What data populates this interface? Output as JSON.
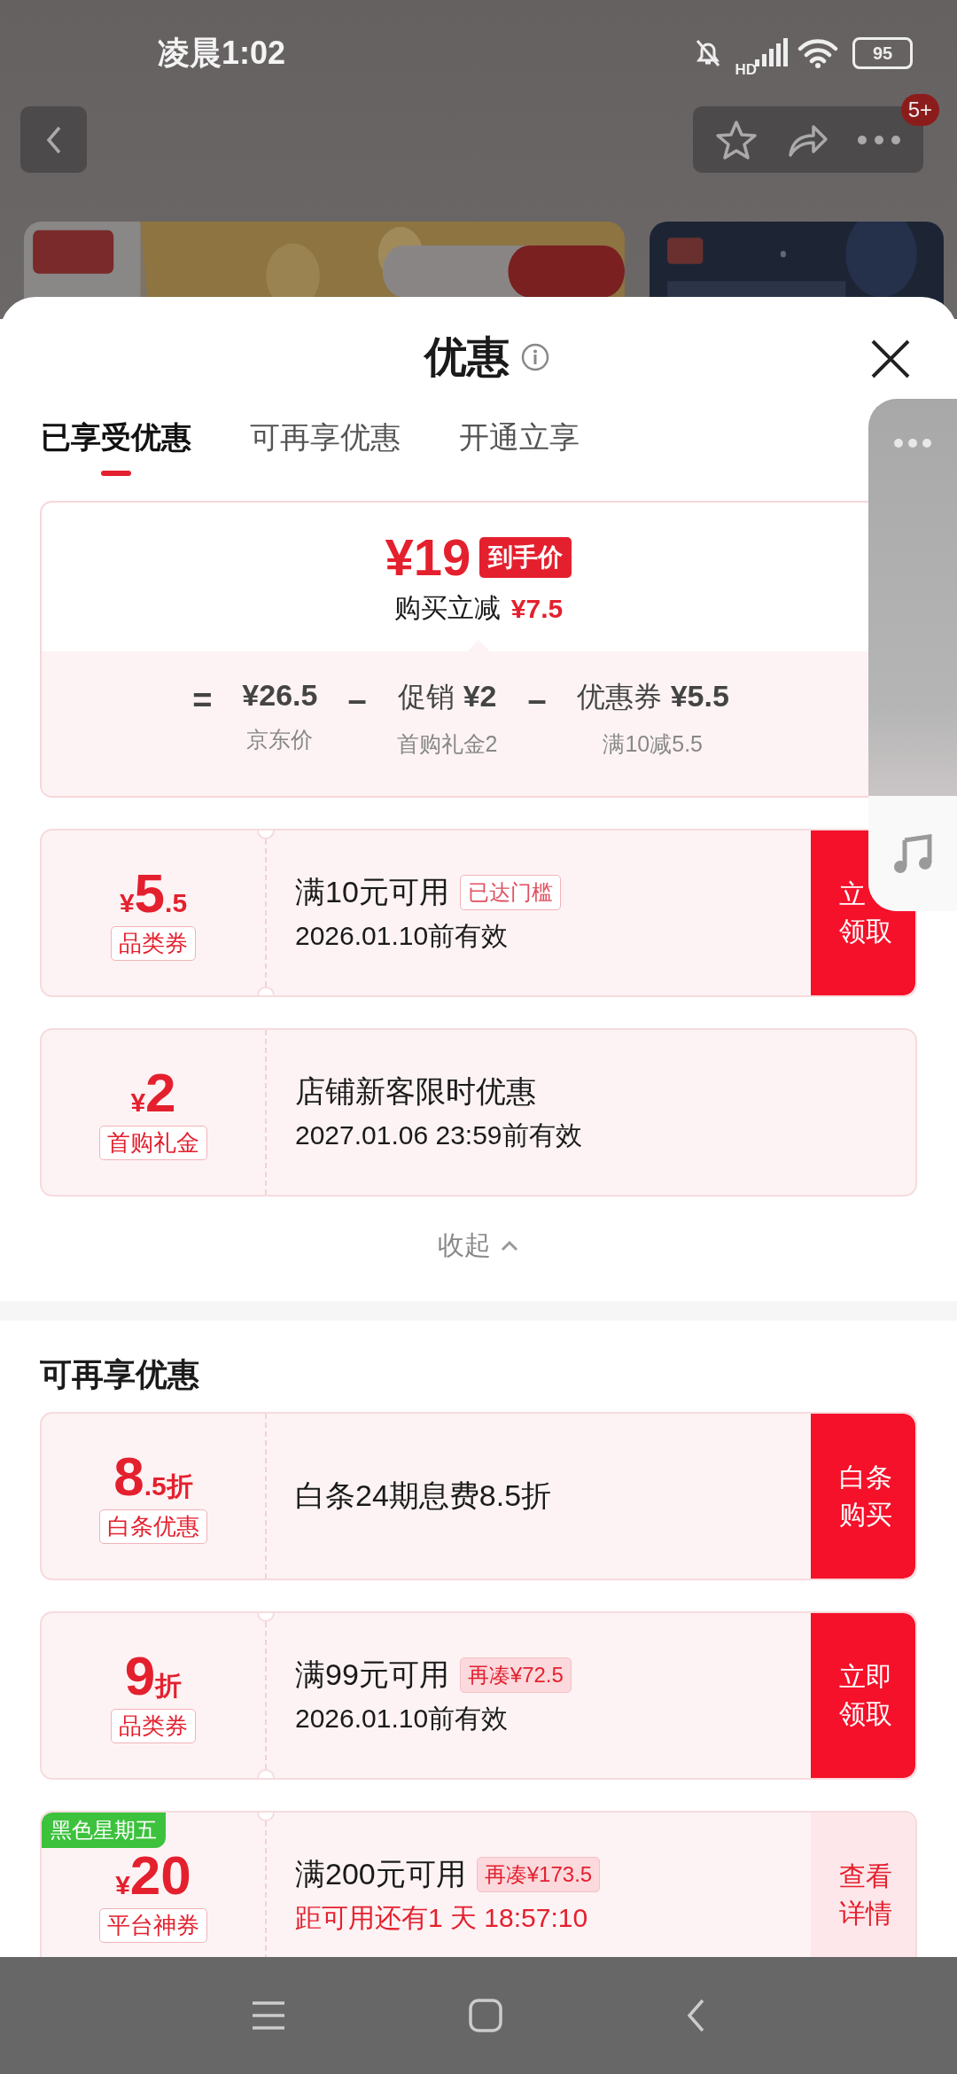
{
  "status_bar": {
    "time": "凌晨1:02",
    "network_label": "HD",
    "battery": "95"
  },
  "top_actions": {
    "badge": "5+"
  },
  "sheet": {
    "title": "优惠"
  },
  "tabs": [
    {
      "label": "已享受优惠",
      "selected": true
    },
    {
      "label": "可再享优惠",
      "selected": false
    },
    {
      "label": "开通立享",
      "selected": false
    }
  ],
  "price_summary": {
    "price": "¥19",
    "price_tag": "到手价",
    "saving_label": "购买立减",
    "saving": "¥7.5",
    "breakdown": [
      {
        "operator": "=",
        "value": "¥26.5",
        "note": "京东价"
      },
      {
        "operator": "–",
        "label": "促销",
        "value": "¥2",
        "note": "首购礼金2"
      },
      {
        "operator": "–",
        "label": "优惠券",
        "value": "¥5.5",
        "note": "满10减5.5"
      }
    ]
  },
  "applied_coupons": [
    {
      "currency": "¥",
      "amount": "5",
      "fraction": ".5",
      "tag": "品类券",
      "title": "满10元可用",
      "badge": {
        "kind": "reached",
        "text": "已达门槛"
      },
      "subtitle": "2026.01.10前有效",
      "subtitle_alert": false,
      "button": {
        "kind": "solid",
        "lines": [
          "立",
          "领取"
        ]
      },
      "notched": true
    },
    {
      "currency": "¥",
      "amount": "2",
      "tag": "首购礼金",
      "title": "店铺新客限时优惠",
      "subtitle": "2027.01.06 23:59前有效",
      "subtitle_alert": false,
      "notched": false
    }
  ],
  "collapse": {
    "label": "收起"
  },
  "more_section": {
    "title": "可再享优惠"
  },
  "more_coupons": [
    {
      "amount": "8",
      "fraction": ".5折",
      "tag": "白条优惠",
      "title": "白条24期息费8.5折",
      "button": {
        "kind": "solid",
        "lines": [
          "白条",
          "购买"
        ]
      },
      "notched": false
    },
    {
      "amount": "9",
      "fraction": "折",
      "tag": "品类券",
      "title": "满99元可用",
      "badge": {
        "kind": "gap",
        "text": "再凑¥72.5"
      },
      "subtitle": "2026.01.10前有效",
      "subtitle_alert": false,
      "button": {
        "kind": "solid",
        "lines": [
          "立即",
          "领取"
        ]
      },
      "notched": true
    },
    {
      "ribbon": "黑色星期五",
      "currency": "¥",
      "amount": "20",
      "tag": "平台神券",
      "title": "满200元可用",
      "badge": {
        "kind": "gap",
        "text": "再凑¥173.5"
      },
      "subtitle": "距可用还有1 天 18:57:10",
      "subtitle_alert": true,
      "button": {
        "kind": "light",
        "lines": [
          "查看",
          "详情"
        ]
      },
      "notched": true
    }
  ]
}
